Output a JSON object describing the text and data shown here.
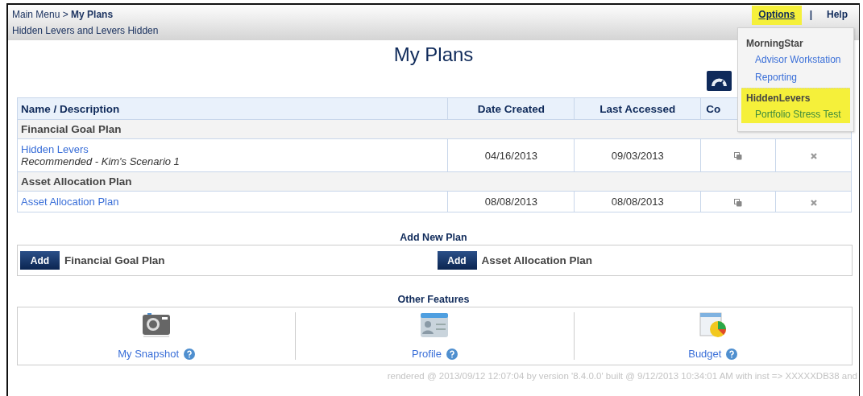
{
  "breadcrumb": {
    "parent": "Main Menu",
    "separator": ">",
    "current": "My Plans"
  },
  "subtitle": "Hidden Levers and Levers Hidden",
  "top_links": [
    {
      "label": "Options",
      "highlighted": true
    },
    {
      "label": "Help",
      "highlighted": false
    }
  ],
  "top_separator": "|",
  "options_menu": [
    {
      "heading": "MorningStar",
      "highlighted": false,
      "items": [
        "Advisor Workstation",
        "Reporting"
      ]
    },
    {
      "heading": "HiddenLevers",
      "highlighted": true,
      "items": [
        "Portfolio Stress Test"
      ]
    }
  ],
  "title": "My Plans",
  "table": {
    "columns": [
      "Name / Description",
      "Date Created",
      "Last Accessed",
      "Co"
    ],
    "groups": [
      {
        "name": "Financial Goal Plan",
        "rows": [
          {
            "name": "Hidden Levers",
            "description": "Recommended - Kim's Scenario 1",
            "date_created": "04/16/2013",
            "last_accessed": "09/03/2013"
          }
        ]
      },
      {
        "name": "Asset Allocation Plan",
        "rows": [
          {
            "name": "Asset Allocation Plan",
            "date_created": "08/08/2013",
            "last_accessed": "08/08/2013"
          }
        ]
      }
    ]
  },
  "add_new_plan": {
    "title": "Add New Plan",
    "items": [
      {
        "button": "Add",
        "label": "Financial Goal Plan"
      },
      {
        "button": "Add",
        "label": "Asset Allocation Plan"
      }
    ]
  },
  "other_features": {
    "title": "Other Features",
    "items": [
      {
        "kind": "camera",
        "label": "My Snapshot"
      },
      {
        "kind": "profile",
        "label": "Profile"
      },
      {
        "kind": "budget",
        "label": "Budget"
      }
    ]
  },
  "footer": "rendered @ 2013/09/12 12:07:04 by version '8.4.0.0' built @ 9/12/2013 10:34:01 AM with inst => XXXXXDB38 and"
}
